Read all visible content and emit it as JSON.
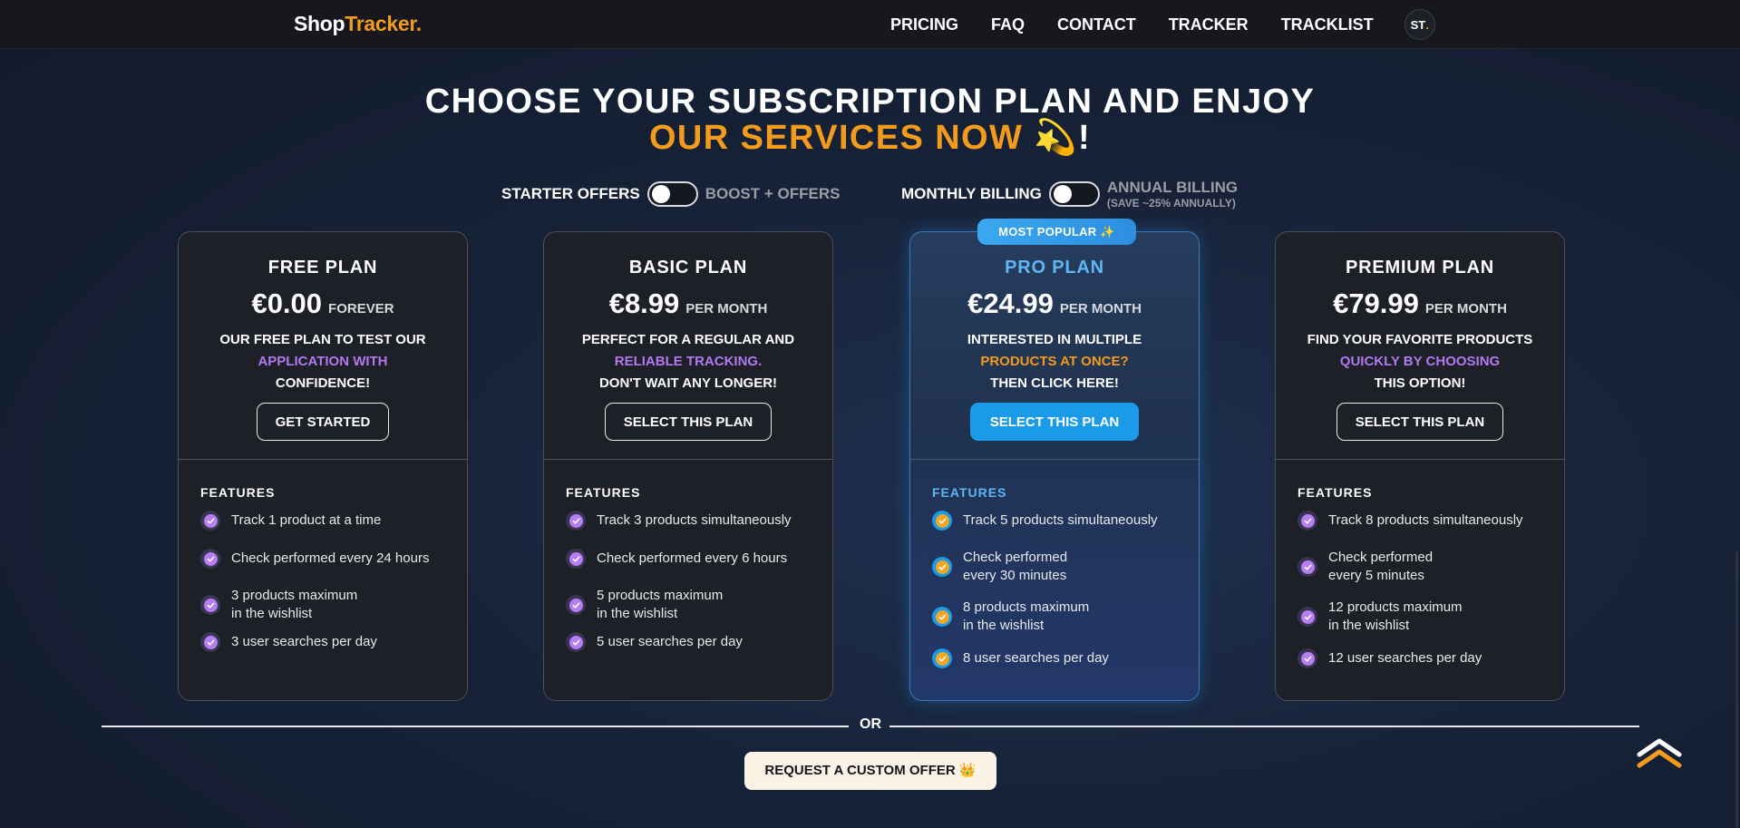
{
  "nav": {
    "logo_part1": "Shop",
    "logo_part2": "Tracker.",
    "links": [
      "PRICING",
      "FAQ",
      "CONTACT",
      "TRACKER",
      "TRACKLIST"
    ],
    "avatar_initials": "ST",
    "avatar_dot": "."
  },
  "headline": {
    "line1": "CHOOSE YOUR SUBSCRIPTION PLAN AND ENJOY",
    "line2_accent": "OUR SERVICES NOW",
    "line2_emoji": "💫",
    "line2_end": "!"
  },
  "toggles": {
    "offers_left": "STARTER OFFERS",
    "offers_right": "BOOST + OFFERS",
    "billing_left": "MONTHLY BILLING",
    "billing_right": "ANNUAL BILLING",
    "billing_note": "(SAVE ~25% ANNUALLY)"
  },
  "plans": [
    {
      "name": "FREE PLAN",
      "price": "€0.00",
      "period": "FOREVER",
      "desc1": "OUR FREE PLAN TO TEST OUR",
      "desc2": "APPLICATION WITH",
      "desc3": "CONFIDENCE!",
      "button": "GET STARTED",
      "features_title": "FEATURES",
      "features": [
        "Track 1 product at a time",
        "Check performed every 24 hours",
        "3 products maximum|in the wishlist",
        "3 user searches per day"
      ]
    },
    {
      "name": "BASIC PLAN",
      "price": "€8.99",
      "period": "PER MONTH",
      "desc1": "PERFECT FOR A REGULAR AND",
      "desc2": "RELIABLE TRACKING.",
      "desc3": "DON'T WAIT ANY LONGER!",
      "button": "SELECT THIS PLAN",
      "features_title": "FEATURES",
      "features": [
        "Track 3 products simultaneously",
        "Check performed every 6 hours",
        "5 products maximum|in the wishlist",
        "5 user searches per day"
      ]
    },
    {
      "name": "PRO PLAN",
      "price": "€24.99",
      "period": "PER MONTH",
      "desc1": "INTERESTED IN MULTIPLE",
      "desc2": "PRODUCTS AT ONCE?",
      "desc3": "THEN CLICK HERE!",
      "button": "SELECT THIS PLAN",
      "features_title": "FEATURES",
      "badge": "MOST POPULAR ✨",
      "features": [
        "Track 5 products simultaneously",
        "Check performed|every 30 minutes",
        "8 products maximum|in the wishlist",
        "8 user searches per day"
      ]
    },
    {
      "name": "PREMIUM PLAN",
      "price": "€79.99",
      "period": "PER MONTH",
      "desc1": "FIND YOUR FAVORITE PRODUCTS",
      "desc2": "QUICKLY BY CHOOSING",
      "desc3": "THIS OPTION!",
      "button": "SELECT THIS PLAN",
      "features_title": "FEATURES",
      "features": [
        "Track 8 products simultaneously",
        "Check performed|every 5 minutes",
        "12 products maximum|in the wishlist",
        "12 user searches per day"
      ]
    }
  ],
  "or_label": "OR",
  "custom_offer": {
    "label": "REQUEST A CUSTOM OFFER",
    "icon": "👑"
  },
  "colors": {
    "accent": "#f29b1d",
    "pro_blue": "#1b9be7",
    "purple": "#b178f2"
  }
}
